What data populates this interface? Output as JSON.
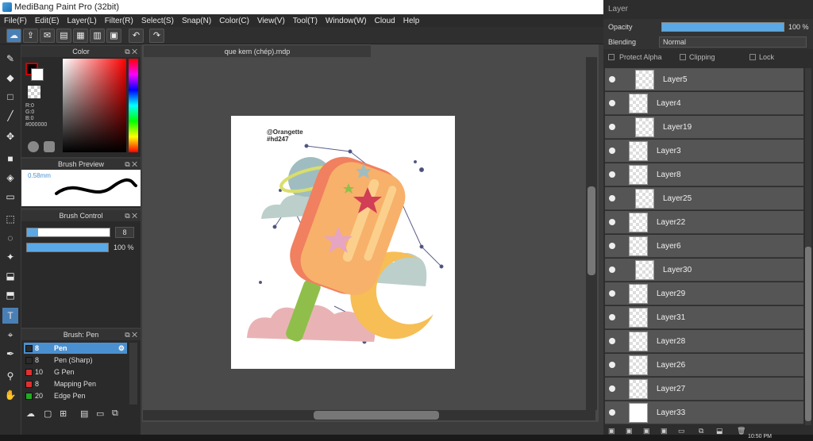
{
  "window": {
    "title": "MediBang Paint Pro (32bit)"
  },
  "menu": [
    "File(F)",
    "Edit(E)",
    "Layer(L)",
    "Filter(R)",
    "Select(S)",
    "Snap(N)",
    "Color(C)",
    "View(V)",
    "Tool(T)",
    "Window(W)",
    "Cloud",
    "Help"
  ],
  "color_panel": {
    "title": "Color",
    "r": "R:0",
    "g": "G:0",
    "b": "B:0",
    "hex": "#000000",
    "primary_color": "#000000",
    "accent": "#cc0000"
  },
  "brush_preview": {
    "title": "Brush Preview",
    "size": "0.58mm"
  },
  "brush_control": {
    "title": "Brush Control",
    "size_value": "8",
    "opacity_value": "100 %",
    "slider_color": "#5aa9e6"
  },
  "brush_list": {
    "title": "Brush: Pen",
    "items": [
      {
        "size": "8",
        "name": "Pen",
        "color": "#2b2b2b",
        "selected": true
      },
      {
        "size": "8",
        "name": "Pen (Sharp)",
        "color": "#2b2b2b"
      },
      {
        "size": "10",
        "name": "G Pen",
        "color": "#e03030"
      },
      {
        "size": "8",
        "name": "Mapping Pen",
        "color": "#e03030"
      },
      {
        "size": "20",
        "name": "Edge Pen",
        "color": "#22aa22"
      }
    ],
    "selected_color": "#4a90d0"
  },
  "document": {
    "tab": "que kem (chép).mdp",
    "artwork_text_1": "@Orangette",
    "artwork_text_2": "#hd247"
  },
  "layer_panel": {
    "title": "Layer",
    "opacity_label": "Opacity",
    "opacity_value": "100 %",
    "blending_label": "Blending",
    "blending_value": "Normal",
    "protect_alpha": "Protect Alpha",
    "clipping": "Clipping",
    "lock": "Lock",
    "layers": [
      {
        "name": "Layer5",
        "clipped": true
      },
      {
        "name": "Layer4",
        "clipped": false
      },
      {
        "name": "Layer19",
        "clipped": true
      },
      {
        "name": "Layer3",
        "clipped": false
      },
      {
        "name": "Layer8",
        "clipped": false
      },
      {
        "name": "Layer25",
        "clipped": true
      },
      {
        "name": "Layer22",
        "clipped": false
      },
      {
        "name": "Layer6",
        "clipped": false
      },
      {
        "name": "Layer30",
        "clipped": true
      },
      {
        "name": "Layer29",
        "clipped": false
      },
      {
        "name": "Layer31",
        "clipped": false
      },
      {
        "name": "Layer28",
        "clipped": false
      },
      {
        "name": "Layer26",
        "clipped": false
      },
      {
        "name": "Layer27",
        "clipped": false
      },
      {
        "name": "Layer33",
        "clipped": false
      }
    ]
  },
  "taskbar": {
    "time": "10:50 PM"
  }
}
